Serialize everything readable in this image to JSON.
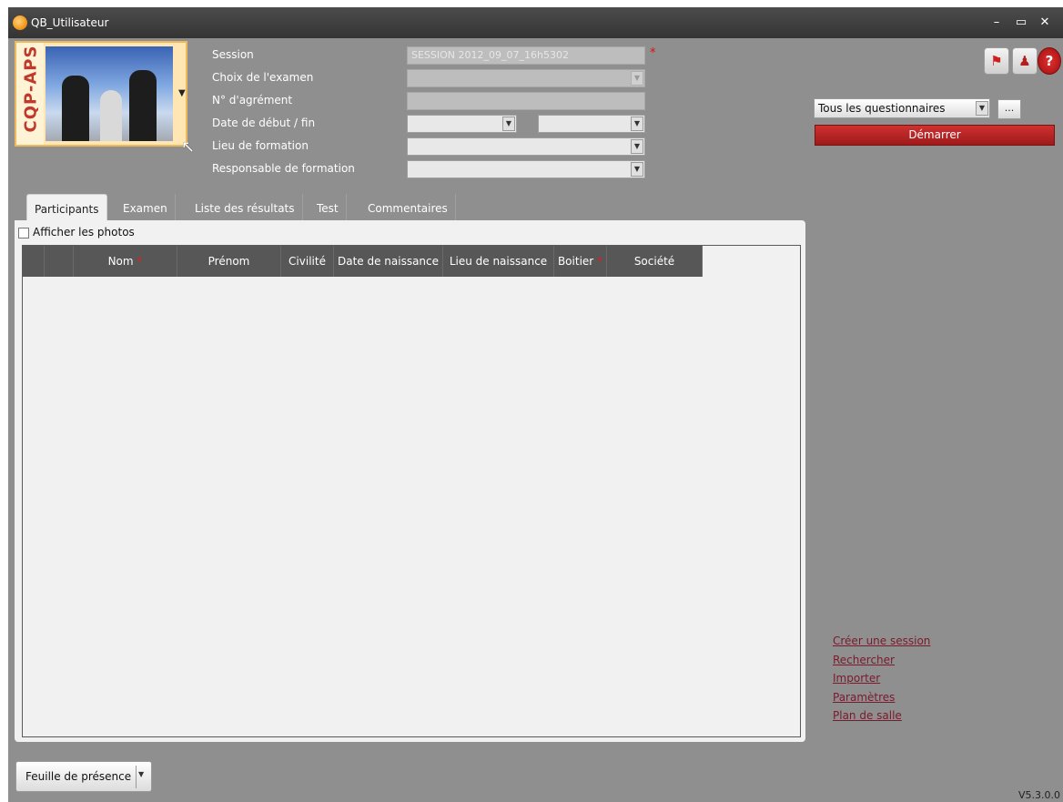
{
  "window": {
    "title": "QB_Utilisateur",
    "minimize": "–",
    "maximize": "▭",
    "close": "✕"
  },
  "logo": {
    "text": "CQP-APS"
  },
  "form": {
    "session_label": "Session",
    "session_value": "SESSION 2012_09_07_16h5302",
    "exam_label": "Choix de l'examen",
    "agrement_label": "N° d'agrément",
    "dates_label": "Date de début / fin",
    "lieu_label": "Lieu de formation",
    "responsable_label": "Responsable de formation",
    "required_mark": "*"
  },
  "tabs": [
    {
      "label": "Participants"
    },
    {
      "label": "Examen"
    },
    {
      "label": "Liste des résultats"
    },
    {
      "label": "Test"
    },
    {
      "label": "Commentaires"
    }
  ],
  "participants": {
    "show_photos_label": "Afficher les photos",
    "columns": [
      {
        "label": ""
      },
      {
        "label": ""
      },
      {
        "label": "Nom"
      },
      {
        "label": "Prénom"
      },
      {
        "label": "Civilité"
      },
      {
        "label": "Date de naissance"
      },
      {
        "label": "Lieu de naissance"
      },
      {
        "label": "Boitier"
      },
      {
        "label": "Société"
      }
    ]
  },
  "right_panel": {
    "questionnaire_select": "Tous les questionnaires",
    "ellipsis": "...",
    "start_button": "Démarrer",
    "links": [
      "Créer une session",
      "Rechercher",
      "Importer",
      "Paramètres",
      "Plan de salle"
    ]
  },
  "bottom": {
    "presence_button": "Feuille de présence",
    "version": "V5.3.0.0"
  },
  "colors": {
    "window_bg": "#8f8f8f",
    "titlebar": "#3c3c3c",
    "accent_red": "#b82222",
    "link_color": "#7a1a2c",
    "grid_header": "#575757"
  }
}
